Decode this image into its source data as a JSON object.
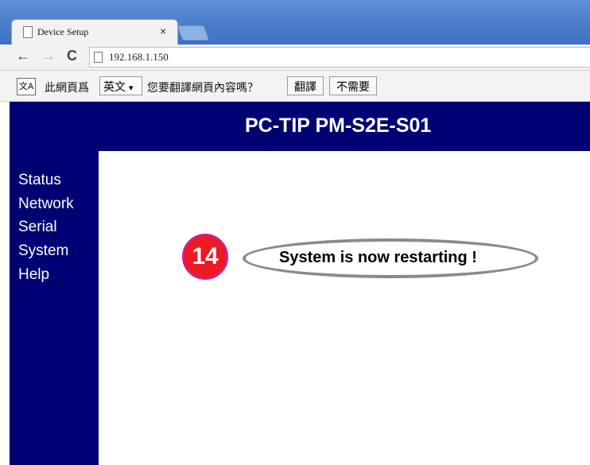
{
  "browser": {
    "tab_title": "Device Setup",
    "tab_close": "×",
    "url": "192.168.1.150",
    "nav": {
      "back": "←",
      "forward": "→",
      "reload": "C"
    }
  },
  "translate_bar": {
    "icon_text": "文A",
    "prompt_prefix": "此網頁爲",
    "language": "英文",
    "language_caret": "▾",
    "prompt_suffix": "您要翻譯網頁內容嗎？",
    "translate_button": "翻譯",
    "decline_button": "不需要"
  },
  "page": {
    "device_title": "PC-TIP PM-S2E-S01",
    "sidebar": [
      {
        "label": "Status"
      },
      {
        "label": "Network"
      },
      {
        "label": "Serial"
      },
      {
        "label": "System"
      },
      {
        "label": "Help"
      }
    ],
    "step_number": "14",
    "status_message": "System is now restarting !"
  },
  "colors": {
    "header_bg": "#000073",
    "badge_fill": "#ee1a22",
    "badge_border": "#d51d8a",
    "ellipse": "#8a8a8a"
  }
}
